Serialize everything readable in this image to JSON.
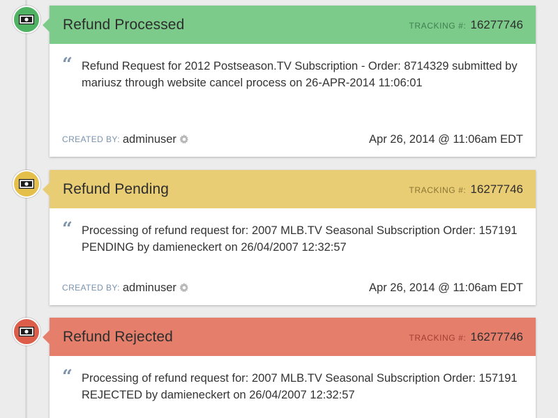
{
  "colors": {
    "processed_header": "#7dcb8a",
    "processed_icon": "#4fb263",
    "pending_header": "#e8cd75",
    "pending_icon": "#e4c04a",
    "rejected_header": "#e57f6c",
    "rejected_icon": "#dd5d4b",
    "tracking_label_green": "#3f7f50",
    "tracking_label_yellow": "#8a7433",
    "tracking_label_red": "#a23e30"
  },
  "entries": [
    {
      "status": "Refund Processed",
      "icon": "money-icon",
      "tracking_label": "TRACKING #:",
      "tracking_number": "16277746",
      "message": "Refund Request for 2012 Postseason.TV Subscription - Order: 8714329 submitted by mariusz through website cancel process on 26-APR-2014 11:06:01",
      "created_by_label": "CREATED BY:",
      "created_by": "adminuser",
      "timestamp": "Apr 26, 2014 @ 11:06am EDT"
    },
    {
      "status": "Refund Pending",
      "icon": "money-icon",
      "tracking_label": "TRACKING #:",
      "tracking_number": "16277746",
      "message": "Processing of refund request for: 2007 MLB.TV Seasonal Subscription Order: 157191 PENDING by damieneckert on 26/04/2007 12:32:57",
      "created_by_label": "CREATED BY:",
      "created_by": "adminuser",
      "timestamp": "Apr 26, 2014 @ 11:06am EDT"
    },
    {
      "status": "Refund Rejected",
      "icon": "money-icon",
      "tracking_label": "TRACKING #:",
      "tracking_number": "16277746",
      "message": "Processing of refund request for: 2007 MLB.TV Seasonal Subscription Order: 157191 REJECTED by damieneckert on 26/04/2007 12:32:57"
    }
  ]
}
